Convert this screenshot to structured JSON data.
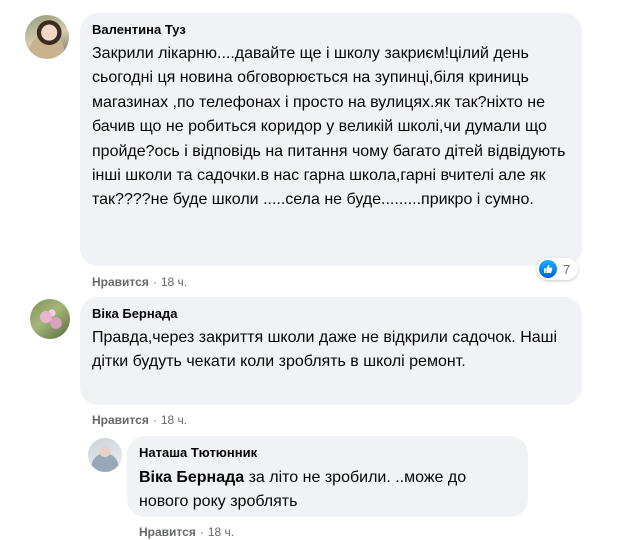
{
  "comments": [
    {
      "author": "Валентина Туз",
      "text": "Закрили лікарню....давайте ще і школу закриєм!цілий день сьогодні ця новина обговорюється на зупинці,біля криниць магазинах ,по телефонах і просто на вулицях.як так?ніхто не бачив що не робиться коридор у великій школі,чи думали що пройде?ось і відповідь на питання чому багато дітей відвідують інші школи та садочки.в нас гарна школа,гарні вчителі але як так????не буде школи .....села не буде.........прикро і сумно.",
      "like_label": "Нравится",
      "time": "18 ч.",
      "reactions": {
        "icon": "like-icon",
        "count": "7"
      }
    },
    {
      "author": "Віка Бернада",
      "text": "Правда,через закриття школи даже не відкрили садочок. Наші дітки будуть чекати коли зроблять в школі ремонт.",
      "like_label": "Нравится",
      "time": "18 ч."
    },
    {
      "author": "Наташа Тютюнник",
      "mention": "Віка Бернада",
      "text": " за літо не зробили. ..може до нового року зроблять",
      "like_label": "Нравится",
      "time": "18 ч."
    }
  ],
  "colors": {
    "bubble": "#f0f2f5",
    "secondary_text": "#65676b",
    "like_blue": "#0062df"
  }
}
